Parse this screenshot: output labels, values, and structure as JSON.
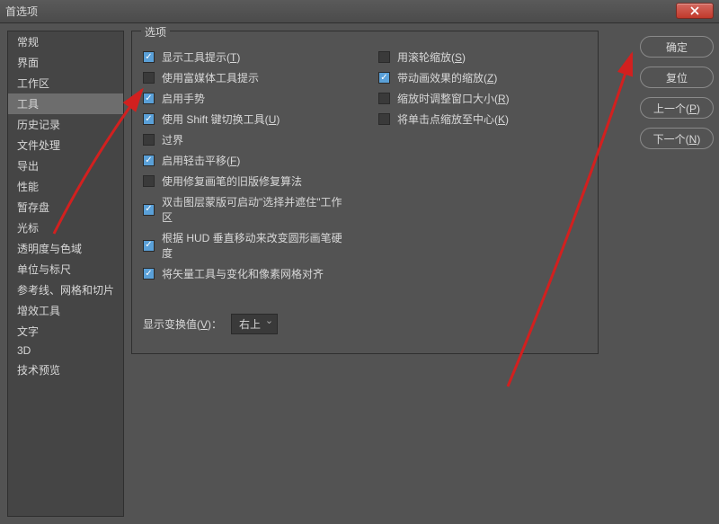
{
  "window": {
    "title": "首选项"
  },
  "sidebar": {
    "items": [
      "常规",
      "界面",
      "工作区",
      "工具",
      "历史记录",
      "文件处理",
      "导出",
      "性能",
      "暂存盘",
      "光标",
      "透明度与色域",
      "单位与标尺",
      "参考线、网格和切片",
      "增效工具",
      "文字",
      "3D",
      "技术预览"
    ],
    "active_index": 3
  },
  "group": {
    "label": "选项"
  },
  "checks_left": [
    {
      "checked": true,
      "label": "显示工具提示",
      "accel": "T"
    },
    {
      "checked": false,
      "label": "使用富媒体工具提示",
      "accel": ""
    },
    {
      "checked": true,
      "label": "启用手势",
      "accel": ""
    },
    {
      "checked": true,
      "label": "使用 Shift 键切换工具",
      "accel": "U"
    },
    {
      "checked": false,
      "label": "过界",
      "accel": ""
    },
    {
      "checked": true,
      "label": "启用轻击平移",
      "accel": "F"
    },
    {
      "checked": false,
      "label": "使用修复画笔的旧版修复算法",
      "accel": ""
    },
    {
      "checked": true,
      "label": "双击图层蒙版可启动\"选择并遮住\"工作区",
      "accel": ""
    },
    {
      "checked": true,
      "label": "根据 HUD 垂直移动来改变圆形画笔硬度",
      "accel": ""
    },
    {
      "checked": true,
      "label": "将矢量工具与变化和像素网格对齐",
      "accel": ""
    }
  ],
  "checks_right": [
    {
      "checked": false,
      "label": "用滚轮缩放",
      "accel": "S"
    },
    {
      "checked": true,
      "label": "带动画效果的缩放",
      "accel": "Z"
    },
    {
      "checked": false,
      "label": "缩放时调整窗口大小",
      "accel": "R"
    },
    {
      "checked": false,
      "label": "将单击点缩放至中心",
      "accel": "K"
    }
  ],
  "dropdown": {
    "label": "显示变换值",
    "accel": "V",
    "value": "右上"
  },
  "buttons": {
    "ok": "确定",
    "reset": "复位",
    "prev_label": "上一个",
    "prev_accel": "P",
    "next_label": "下一个",
    "next_accel": "N"
  }
}
